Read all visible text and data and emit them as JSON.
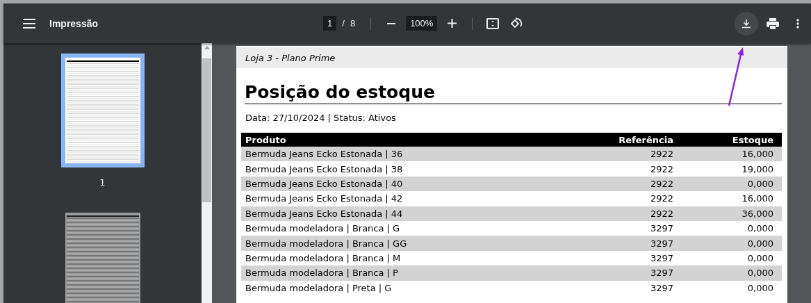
{
  "toolbar": {
    "title": "Impressão",
    "page_current": "1",
    "page_total": "8",
    "page_separator": "/",
    "zoom": "100%"
  },
  "thumbnails": [
    {
      "label": "1",
      "selected": true
    },
    {
      "selected": false
    }
  ],
  "document": {
    "header": "Loja 3 - Plano Prime",
    "title": "Posição do estoque",
    "subtitle": "Data: 27/10/2024 | Status: Ativos",
    "table": {
      "columns": [
        "Produto",
        "Referência",
        "Estoque"
      ],
      "rows": [
        [
          "Bermuda Jeans Ecko Estonada | 36",
          "2922",
          "16,000"
        ],
        [
          "Bermuda Jeans Ecko Estonada | 38",
          "2922",
          "19,000"
        ],
        [
          "Bermuda Jeans Ecko Estonada | 40",
          "2922",
          "0,000"
        ],
        [
          "Bermuda Jeans Ecko Estonada | 42",
          "2922",
          "16,000"
        ],
        [
          "Bermuda Jeans Ecko Estonada | 44",
          "2922",
          "36,000"
        ],
        [
          "Bermuda modeladora | Branca | G",
          "3297",
          "0,000"
        ],
        [
          "Bermuda modeladora | Branca | GG",
          "3297",
          "0,000"
        ],
        [
          "Bermuda modeladora | Branca | M",
          "3297",
          "0,000"
        ],
        [
          "Bermuda modeladora | Branca | P",
          "3297",
          "0,000"
        ],
        [
          "Bermuda modeladora | Preta | G",
          "3297",
          "0,000"
        ]
      ]
    }
  }
}
